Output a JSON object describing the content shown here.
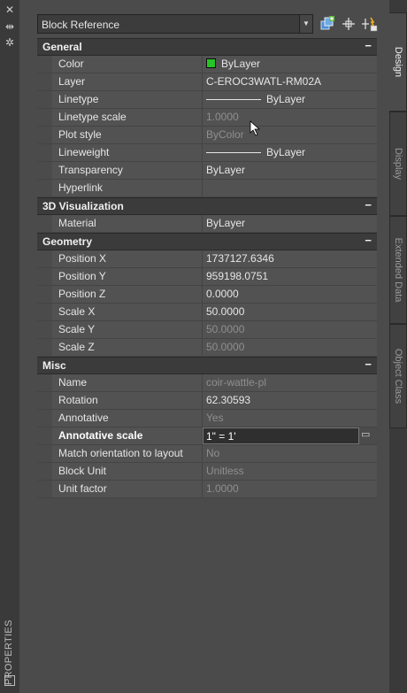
{
  "strip": {
    "title": "PROPERTIES"
  },
  "selector": {
    "value": "Block Reference"
  },
  "tabs": [
    {
      "label": "Design",
      "selected": true
    },
    {
      "label": "Display",
      "selected": false
    },
    {
      "label": "Extended Data",
      "selected": false
    },
    {
      "label": "Object Class",
      "selected": false
    }
  ],
  "categories": {
    "general": {
      "title": "General",
      "rows": [
        {
          "name": "Color",
          "value": "ByLayer"
        },
        {
          "name": "Layer",
          "value": "C-EROC3WATL-RM02A"
        },
        {
          "name": "Linetype",
          "value": "ByLayer"
        },
        {
          "name": "Linetype scale",
          "value": "1.0000"
        },
        {
          "name": "Plot style",
          "value": "ByColor"
        },
        {
          "name": "Lineweight",
          "value": "ByLayer"
        },
        {
          "name": "Transparency",
          "value": "ByLayer"
        },
        {
          "name": "Hyperlink",
          "value": ""
        }
      ]
    },
    "viz": {
      "title": "3D Visualization",
      "rows": [
        {
          "name": "Material",
          "value": "ByLayer"
        }
      ]
    },
    "geometry": {
      "title": "Geometry",
      "rows": [
        {
          "name": "Position X",
          "value": "1737127.6346"
        },
        {
          "name": "Position Y",
          "value": "959198.0751"
        },
        {
          "name": "Position Z",
          "value": "0.0000"
        },
        {
          "name": "Scale X",
          "value": "50.0000"
        },
        {
          "name": "Scale Y",
          "value": "50.0000"
        },
        {
          "name": "Scale Z",
          "value": "50.0000"
        }
      ]
    },
    "misc": {
      "title": "Misc",
      "rows": [
        {
          "name": "Name",
          "value": "coir-wattle-pl"
        },
        {
          "name": "Rotation",
          "value": "62.30593"
        },
        {
          "name": "Annotative",
          "value": "Yes"
        },
        {
          "name": "Annotative scale",
          "value": "1\" = 1'"
        },
        {
          "name": "Match orientation to layout",
          "value": "No"
        },
        {
          "name": "Block Unit",
          "value": "Unitless"
        },
        {
          "name": "Unit factor",
          "value": "1.0000"
        }
      ]
    }
  },
  "colors": {
    "swatch": "#26c426",
    "background": "#4b4b4b",
    "row": "#525252"
  }
}
